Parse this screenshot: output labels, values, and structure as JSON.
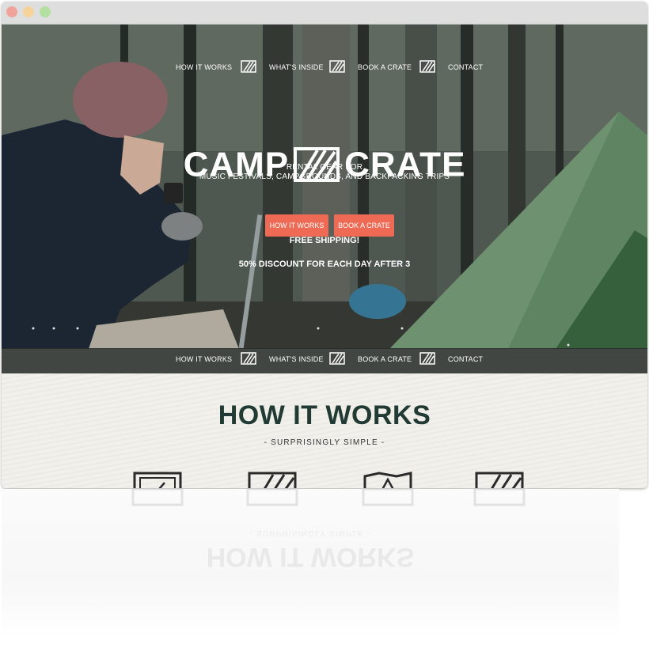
{
  "window": {
    "controls": [
      "close-button",
      "minimize-button",
      "zoom-button"
    ]
  },
  "nav": {
    "items": [
      "HOW IT WORKS",
      "WHAT'S INSIDE",
      "BOOK A CRATE",
      "CONTACT"
    ],
    "separator_icon": "crate-logo-icon"
  },
  "hero": {
    "logo_left": "CAMP",
    "logo_right": "CRATE",
    "tagline_line1": "RENTAL GEAR FOR",
    "tagline_line2": "MUSIC FESTIVALS, CAMPGROUNDS, AND BACKPACKING TRIPS",
    "buttons": [
      "HOW IT WORKS",
      "BOOK A CRATE"
    ],
    "promo1": "FREE SHIPPING!",
    "promo2": "50% DISCOUNT FOR EACH DAY AFTER 3",
    "button_color": "#ef6a54"
  },
  "section": {
    "title": "HOW IT WORKS",
    "subtitle": "- SURPRISINGLY SIMPLE -",
    "step_icons": [
      "laptop-icon",
      "crate-icon",
      "tent-map-icon",
      "crate-return-icon"
    ],
    "title_color": "#213a34"
  }
}
